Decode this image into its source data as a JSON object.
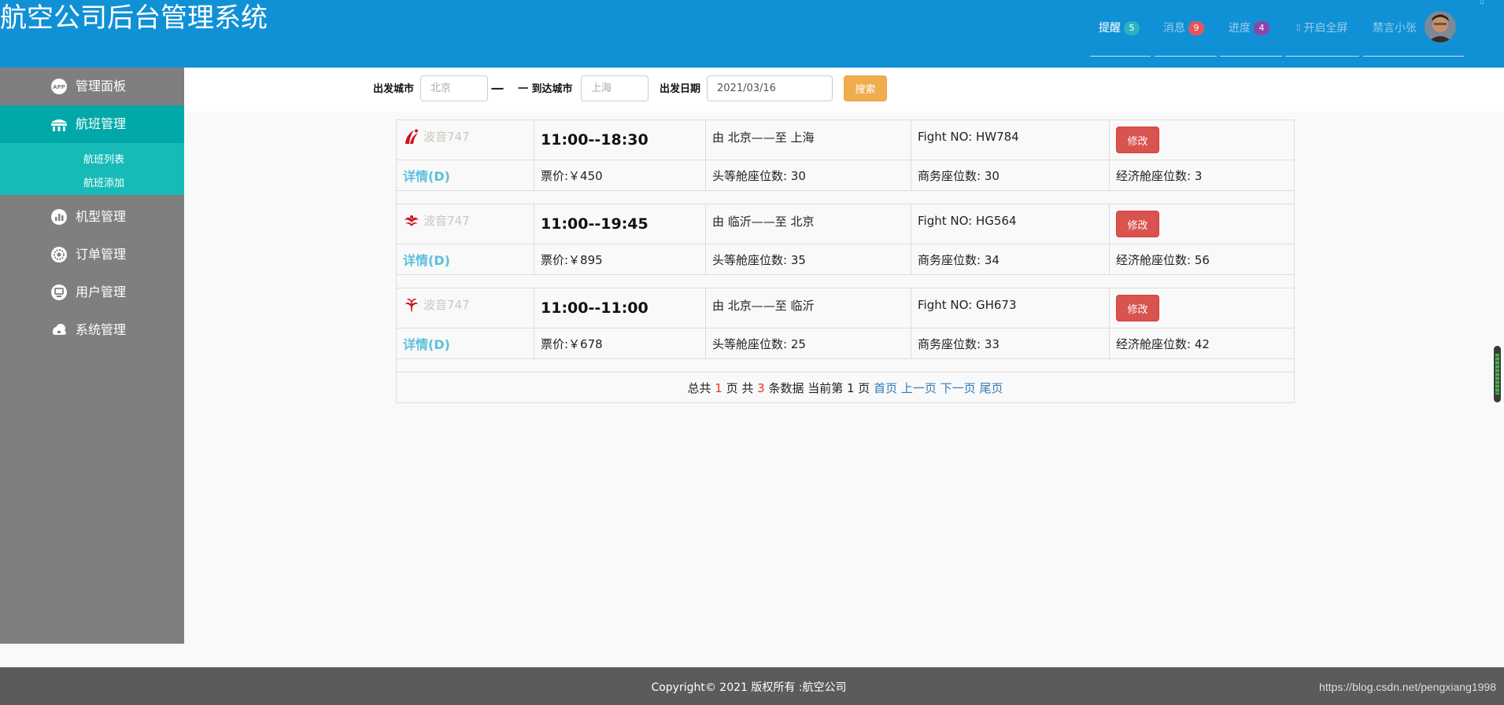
{
  "header": {
    "title": "航空公司后台管理系统",
    "nav": [
      {
        "label": "提醒",
        "badge": "5",
        "badge_color": "#2ab3c0"
      },
      {
        "label": "消息",
        "badge": "9",
        "badge_color": "#e9545a"
      },
      {
        "label": "进度",
        "badge": "4",
        "badge_color": "#8e44ad"
      },
      {
        "label": "开启全屏",
        "icon": "fullscreen-icon"
      }
    ],
    "user_name": "禁言小张",
    "accent_color": "#1191d5"
  },
  "sidebar": {
    "items": [
      {
        "label": "管理面板",
        "icon": "app-icon"
      },
      {
        "label": "航班管理",
        "icon": "bridge-icon",
        "active": true
      },
      {
        "label": "机型管理",
        "icon": "chart-icon"
      },
      {
        "label": "订单管理",
        "icon": "gear-icon"
      },
      {
        "label": "用户管理",
        "icon": "monitor-icon"
      },
      {
        "label": "系统管理",
        "icon": "cloud-icon"
      }
    ],
    "sub_items": [
      "航班列表",
      "航班添加"
    ]
  },
  "search": {
    "from_label": "出发城市",
    "from_placeholder": "北京",
    "separator": "一",
    "to_label": "一 到达城市",
    "to_placeholder": "上海",
    "date_label": "出发日期",
    "date_value": "2021/03/16",
    "button_label": "搜索"
  },
  "flights": [
    {
      "plane": "波音747",
      "time": "11:00--18:30",
      "route": "由 北京——至 上海",
      "fno": "Fight NO: HW784",
      "edit_label": "修改",
      "detail_label": "详情(D)",
      "price": "票价:￥450",
      "first": "头等舱座位数: 30",
      "business": "商务座位数: 30",
      "economy": "经济舱座位数: 3",
      "logo": "air-china-logo"
    },
    {
      "plane": "波音747",
      "time": "11:00--19:45",
      "route": "由 临沂——至 北京",
      "fno": "Fight NO: HG564",
      "edit_label": "修改",
      "detail_label": "详情(D)",
      "price": "票价:￥895",
      "first": "头等舱座位数: 35",
      "business": "商务座位数: 34",
      "economy": "经济舱座位数: 56",
      "logo": "shandong-airlines-logo"
    },
    {
      "plane": "波音747",
      "time": "11:00--11:00",
      "route": "由 北京——至 临沂",
      "fno": "Fight NO: GH673",
      "edit_label": "修改",
      "detail_label": "详情(D)",
      "price": "票价:￥678",
      "first": "头等舱座位数: 25",
      "business": "商务座位数: 33",
      "economy": "经济舱座位数: 42",
      "logo": "china-southern-logo"
    }
  ],
  "pager": {
    "t1": "总共 ",
    "pages": "1",
    "t2": " 页 共 ",
    "records": "3",
    "t3": " 条数据 当前第 1 页 ",
    "first": "首页",
    "prev": "上一页",
    "next": "下一页",
    "last": "尾页"
  },
  "footer": {
    "copyright": "Copyright© 2021 版权所有 :航空公司",
    "watermark": "https://blog.csdn.net/pengxiang1998"
  }
}
